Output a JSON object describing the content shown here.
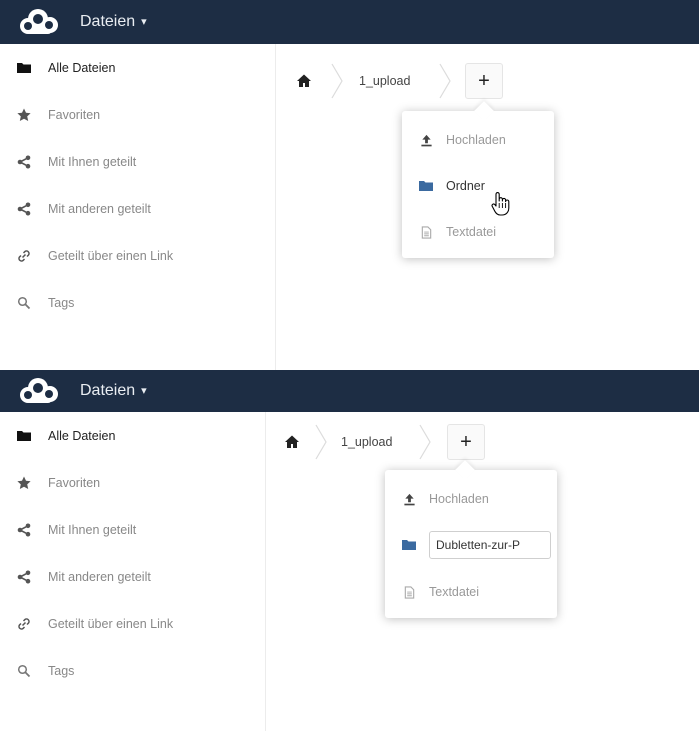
{
  "app": {
    "title": "Dateien",
    "caret": "▾"
  },
  "sidebar": {
    "items": [
      {
        "label": "Alle Dateien",
        "icon": "folder-icon"
      },
      {
        "label": "Favoriten",
        "icon": "star-icon"
      },
      {
        "label": "Mit Ihnen geteilt",
        "icon": "share-icon"
      },
      {
        "label": "Mit anderen geteilt",
        "icon": "share-icon"
      },
      {
        "label": "Geteilt über einen Link",
        "icon": "link-icon"
      },
      {
        "label": "Tags",
        "icon": "search-icon"
      }
    ]
  },
  "breadcrumb": {
    "folder": "1_upload",
    "add_label": "+"
  },
  "new_menu": {
    "upload_label": "Hochladen",
    "folder_label": "Ordner",
    "textfile_label": "Textdatei",
    "folder_name_value": "Dubletten-zur-P"
  },
  "colors": {
    "header": "#1d2d44",
    "folder": "#3b6aa0",
    "icon_grey": "#8a8a8a"
  }
}
